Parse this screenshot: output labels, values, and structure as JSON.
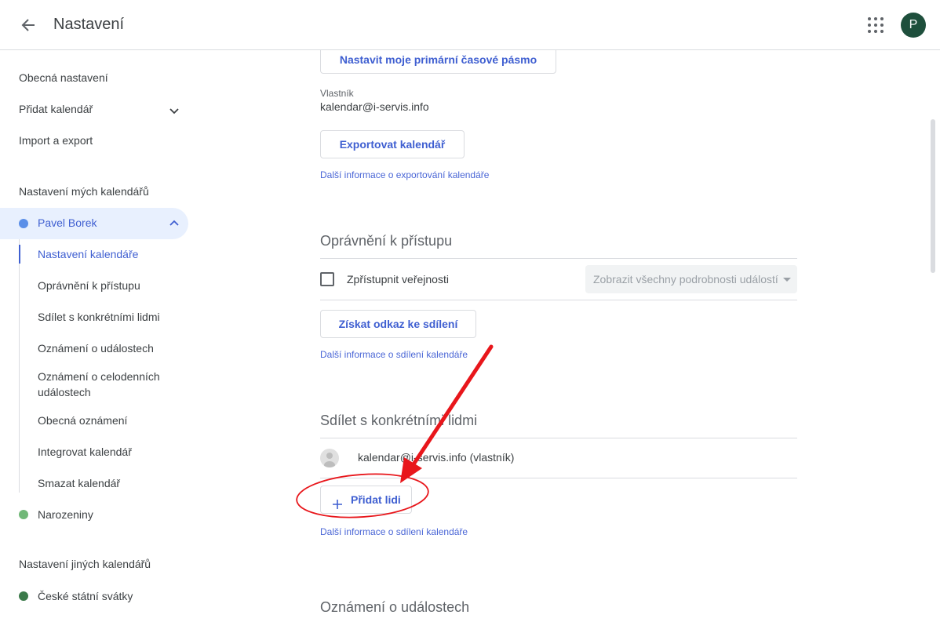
{
  "header": {
    "title": "Nastavení",
    "avatar_letter": "P",
    "back_icon": "arrow-left-icon",
    "apps_icon": "apps-grid-icon"
  },
  "sidebar": {
    "items": [
      {
        "label": "Obecná nastavení"
      },
      {
        "label": "Přidat kalendář"
      },
      {
        "label": "Import a export"
      }
    ],
    "my_calendars_heading": "Nastavení mých kalendářů",
    "active_calendar": {
      "label": "Pavel Borek",
      "color": "#5b8fe8"
    },
    "sub_items": [
      {
        "label": "Nastavení kalendáře"
      },
      {
        "label": "Oprávnění k přístupu"
      },
      {
        "label": "Sdílet s konkrétními lidmi"
      },
      {
        "label": "Oznámení o událostech"
      },
      {
        "label": "Oznámení o celodenních událostech"
      },
      {
        "label": "Obecná oznámení"
      },
      {
        "label": "Integrovat kalendář"
      },
      {
        "label": "Smazat kalendář"
      }
    ],
    "birthday_calendar": {
      "label": "Narozeniny",
      "color": "#71b878"
    },
    "other_calendars_heading": "Nastavení jiných kalendářů",
    "other_calendars": [
      {
        "label": "České státní svátky",
        "color": "#3b7a4a"
      }
    ]
  },
  "main": {
    "timezone_button": "Nastavit moje primární časové pásmo",
    "owner_label": "Vlastník",
    "owner_value": "kalendar@i-servis.info",
    "export_button": "Exportovat kalendář",
    "export_link": "Další informace o exportování kalendáře",
    "access": {
      "title": "Oprávnění k přístupu",
      "public_label": "Zpřístupnit veřejnosti",
      "public_checked": false,
      "detail_select": "Zobrazit všechny podrobnosti událostí",
      "share_link_button": "Získat odkaz ke sdílení",
      "info_link": "Další informace o sdílení kalendáře"
    },
    "share": {
      "title": "Sdílet s konkrétními lidmi",
      "person": "kalendar@i-servis.info (vlastník)",
      "add_button": "Přidat lidi",
      "info_link": "Další informace o sdílení kalendáře"
    },
    "notifications_title": "Oznámení o událostech"
  },
  "colors": {
    "accent": "#3f5fd1",
    "annotation": "#e8161b"
  }
}
